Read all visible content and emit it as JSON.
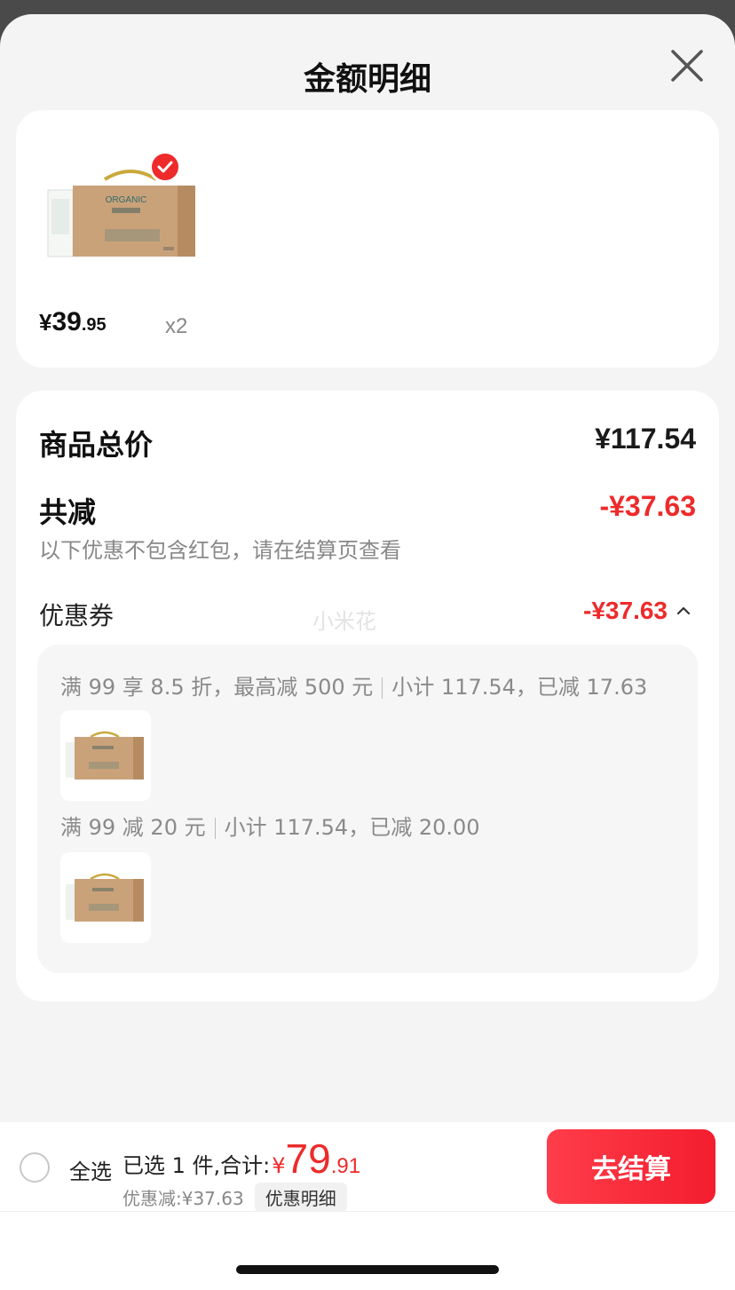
{
  "sheet": {
    "title": "金额明细"
  },
  "product": {
    "price_currency": "¥",
    "price_integer": "39",
    "price_decimal": ".95",
    "quantity": "x2",
    "image_brand": "ORGANIC",
    "selected": true
  },
  "summary": {
    "total_label": "商品总价",
    "total_value": "¥117.54",
    "reduction_label": "共减",
    "reduction_value": "-¥37.63",
    "note": "以下优惠不包含红包，请在结算页查看",
    "coupon_label": "优惠券",
    "coupon_value": "-¥37.63",
    "watermark": "小米花",
    "coupons": [
      {
        "rule": "满 99 享 8.5 折，最高减 500 元",
        "detail": "小计 117.54，已减 17.63"
      },
      {
        "rule": "满 99 减 20 元",
        "detail": "小计 117.54，已减 20.00"
      }
    ]
  },
  "bottom": {
    "select_all": "全选",
    "selected_prefix": "已选 1 件,合计:",
    "currency": "¥",
    "total_int": "79",
    "total_dec": ".91",
    "discount_text": "优惠减:¥37.63",
    "detail_chip": "优惠明细",
    "checkout": "去结算"
  },
  "colors": {
    "accent": "#ee2a2a",
    "background": "#f4f4f4"
  },
  "icons": [
    "close-icon",
    "check-icon",
    "chevron-up-icon",
    "radio-unchecked-icon"
  ]
}
